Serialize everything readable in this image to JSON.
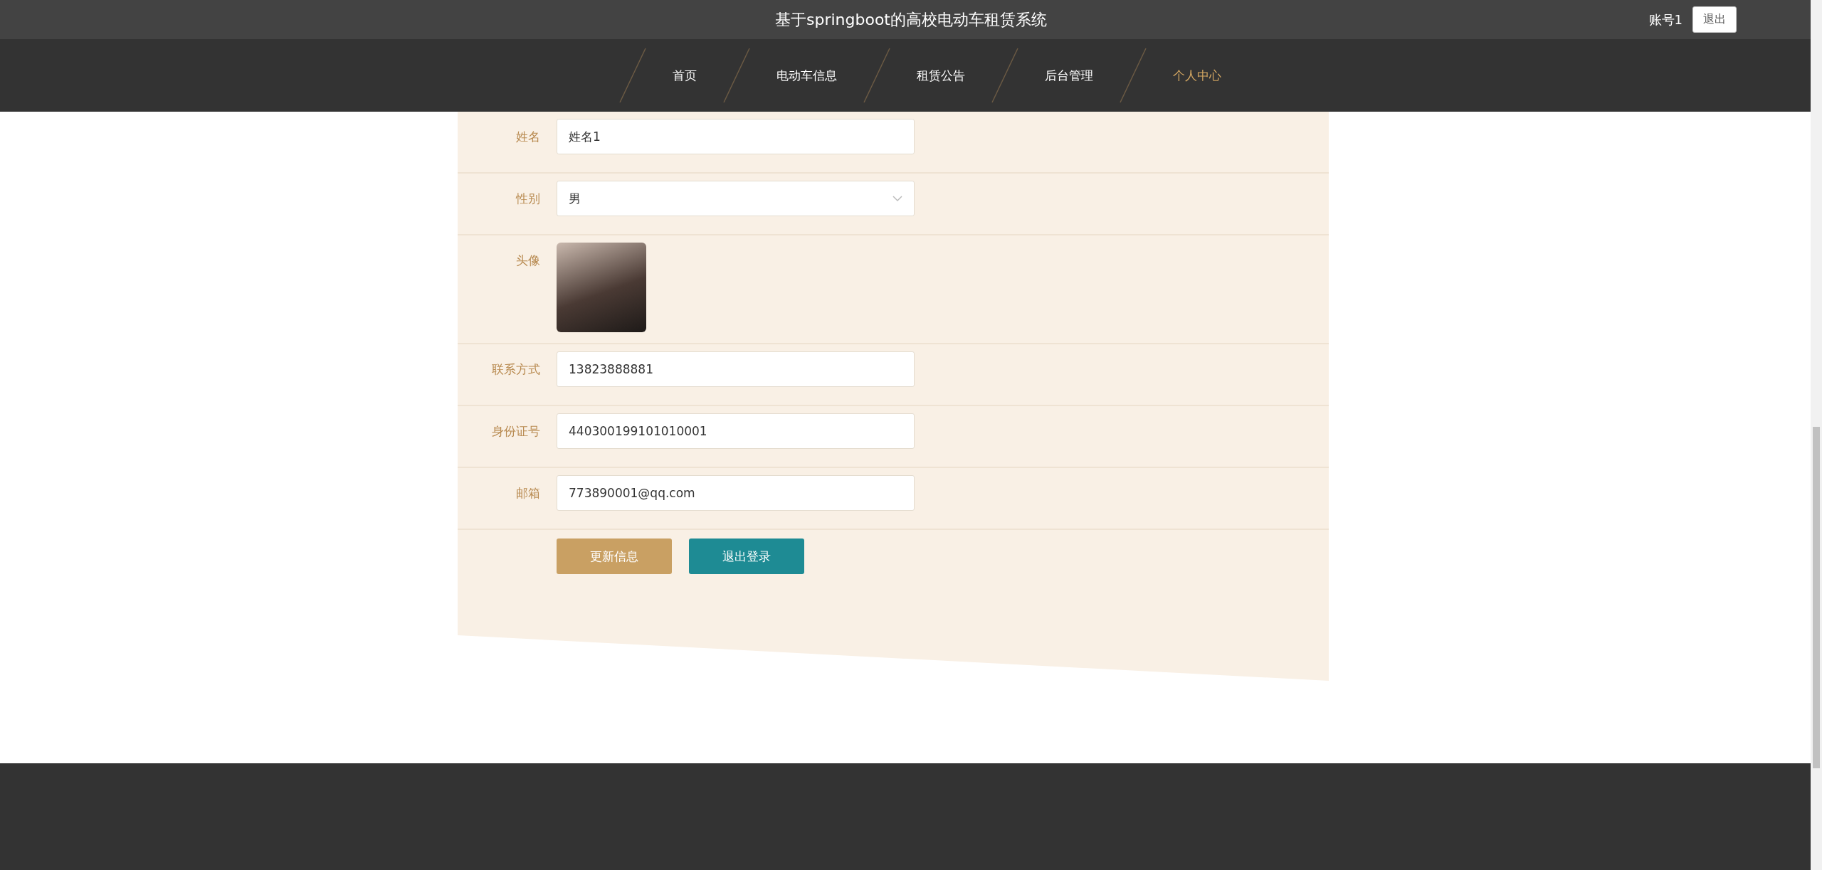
{
  "header": {
    "title": "基于springboot的高校电动车租赁系统",
    "account": "账号1",
    "logout": "退出"
  },
  "nav": [
    {
      "label": "首页",
      "selected": false
    },
    {
      "label": "电动车信息",
      "selected": false
    },
    {
      "label": "租赁公告",
      "selected": false
    },
    {
      "label": "后台管理",
      "selected": false
    },
    {
      "label": "个人中心",
      "selected": true
    }
  ],
  "form": {
    "fields": [
      {
        "kind": "input",
        "label": "姓名",
        "value": "姓名1"
      },
      {
        "kind": "select",
        "label": "性别",
        "value": "男"
      },
      {
        "kind": "image",
        "label": "头像"
      },
      {
        "kind": "input",
        "label": "联系方式",
        "value": "13823888881"
      },
      {
        "kind": "input",
        "label": "身份证号",
        "value": "440300199101010001"
      },
      {
        "kind": "input",
        "label": "邮箱",
        "value": "773890001@qq.com"
      }
    ],
    "buttons": [
      {
        "kind": "primary",
        "label": "更新信息"
      },
      {
        "kind": "secondary",
        "label": "退出登录"
      }
    ]
  }
}
